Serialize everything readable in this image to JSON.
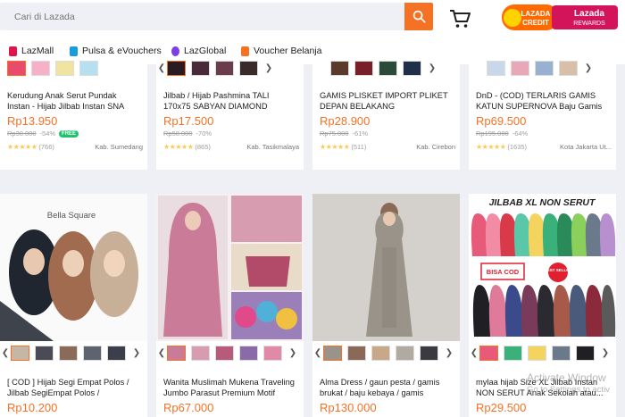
{
  "search": {
    "placeholder": "Cari di Lazada"
  },
  "promo": {
    "left_line1": "LAZADA",
    "left_line2": "CREDIT",
    "right_line1": "Lazada",
    "right_line2": "REWARDS"
  },
  "nav": [
    {
      "label": "LazMall",
      "icon": "lazmall-icon",
      "color": "#e0144c"
    },
    {
      "label": "Pulsa & eVouchers",
      "icon": "phone-icon",
      "color": "#1a9cd8"
    },
    {
      "label": "LazGlobal",
      "icon": "globe-icon",
      "color": "#7b3fe4"
    },
    {
      "label": "Voucher Belanja",
      "icon": "voucher-icon",
      "color": "#f57224"
    }
  ],
  "products_top": [
    {
      "name": "Kerudung Anak Serut Pundak Instan - Hijab Jilbab Instan SNA Konveksi...",
      "price": "Rp13.950",
      "old_price": "Rp30.000",
      "discount": "-54%",
      "free": "FREE",
      "stars": "★★★★★",
      "reviews": "(766)",
      "location": "Kab. Sumedang"
    },
    {
      "name": "Jilbab / Hijab Pashmina TALI 170x75 SABYAN DIAMOND Panjang...",
      "price": "Rp17.500",
      "old_price": "Rp58.000",
      "discount": "-70%",
      "free": "",
      "stars": "★★★★★",
      "reviews": "(865)",
      "location": "Kab. Tasikmalaya"
    },
    {
      "name": "GAMIS PLISKET IMPORT PLIKET DEPAN BELAKANG",
      "price": "Rp28.900",
      "old_price": "Rp75.000",
      "discount": "-61%",
      "free": "",
      "stars": "★★★★★",
      "reviews": "(511)",
      "location": "Kab. Cirebon"
    },
    {
      "name": "DnD - (COD) TERLARIS GAMIS KATUN SUPERNOVA Baju Gamis Gamis...",
      "price": "Rp69.500",
      "old_price": "Rp195.000",
      "discount": "-64%",
      "free": "",
      "stars": "★★★★★",
      "reviews": "(1635)",
      "location": "Kota Jakarta Ut..."
    }
  ],
  "products_bottom": [
    {
      "name": "[ COD ] Hijab Segi Empat Polos / Jilbab SegiEmpat Polos / Kerudung...",
      "price": "Rp10.200",
      "brand_text": "Bella Square"
    },
    {
      "name": "Wanita Muslimah Mukena Traveling Jumbo Parasut Premium Motif War...",
      "price": "Rp67.000"
    },
    {
      "name": "Alma Dress / gaun pesta / gamis brukat / baju kebaya / gamis wanita...",
      "price": "Rp130.000"
    },
    {
      "name": "mylaa hijab Size XL Jilbab Instan NON SERUT Anak Sekolah atau...",
      "price": "Rp29.500",
      "banner": "JILBAB XL NON SERUT",
      "cod": "BISA COD",
      "best": "BEST SELLER"
    }
  ],
  "thumb_arrows": {
    "left": "❮",
    "right": "❯"
  },
  "watermark": {
    "line1": "Activate Window",
    "line2": "Go to Settings to activ"
  },
  "colors": {
    "accent": "#f57224",
    "price": "#f57224",
    "background": "#eff0f5"
  }
}
